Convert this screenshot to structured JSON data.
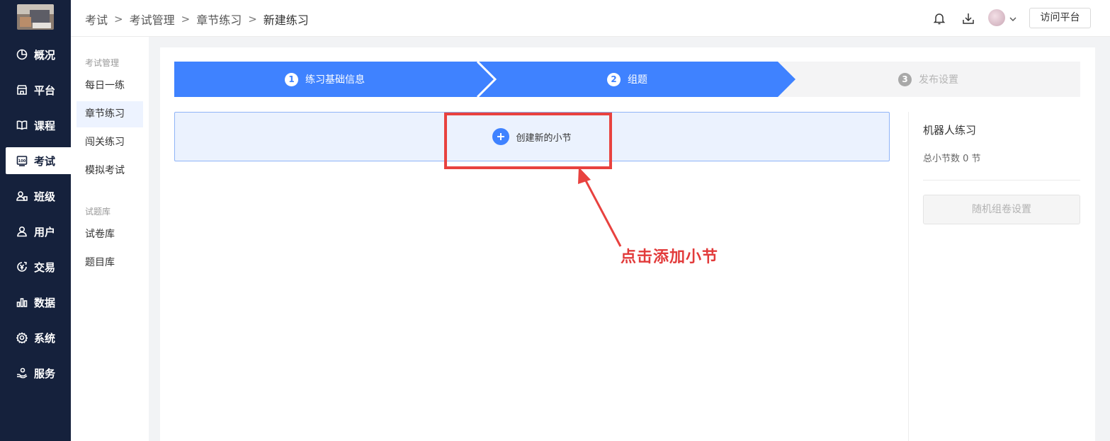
{
  "nav": {
    "items": [
      {
        "label": "概况",
        "icon": "pie-chart-icon"
      },
      {
        "label": "平台",
        "icon": "store-icon"
      },
      {
        "label": "课程",
        "icon": "book-icon"
      },
      {
        "label": "考试",
        "icon": "exam-100-icon",
        "active": true
      },
      {
        "label": "班级",
        "icon": "users-icon"
      },
      {
        "label": "用户",
        "icon": "user-icon"
      },
      {
        "label": "交易",
        "icon": "yen-icon"
      },
      {
        "label": "数据",
        "icon": "bar-chart-icon"
      },
      {
        "label": "系统",
        "icon": "gear-icon"
      },
      {
        "label": "服务",
        "icon": "service-hand-icon"
      }
    ]
  },
  "subnav": {
    "group1": "考试管理",
    "items1": [
      "每日一练",
      "章节练习",
      "闯关练习",
      "模拟考试"
    ],
    "active": "章节练习",
    "group2": "试题库",
    "items2": [
      "试卷库",
      "题目库"
    ]
  },
  "header": {
    "breadcrumb": [
      "考试",
      "考试管理",
      "章节练习",
      "新建练习"
    ],
    "visit_button": "访问平台"
  },
  "steps": [
    {
      "num": "1",
      "label": "练习基础信息",
      "state": "done"
    },
    {
      "num": "2",
      "label": "组题",
      "state": "active"
    },
    {
      "num": "3",
      "label": "发布设置",
      "state": "todo"
    }
  ],
  "create_section": {
    "label": "创建新的小节"
  },
  "annotation": {
    "text": "点击添加小节",
    "color": "#e23b3b"
  },
  "right_panel": {
    "title": "机器人练习",
    "count_text": "总小节数 0 节",
    "random_button": "随机组卷设置"
  },
  "colors": {
    "accent": "#3f82ff",
    "nav_bg": "#15213c",
    "highlight": "#e8423f"
  }
}
